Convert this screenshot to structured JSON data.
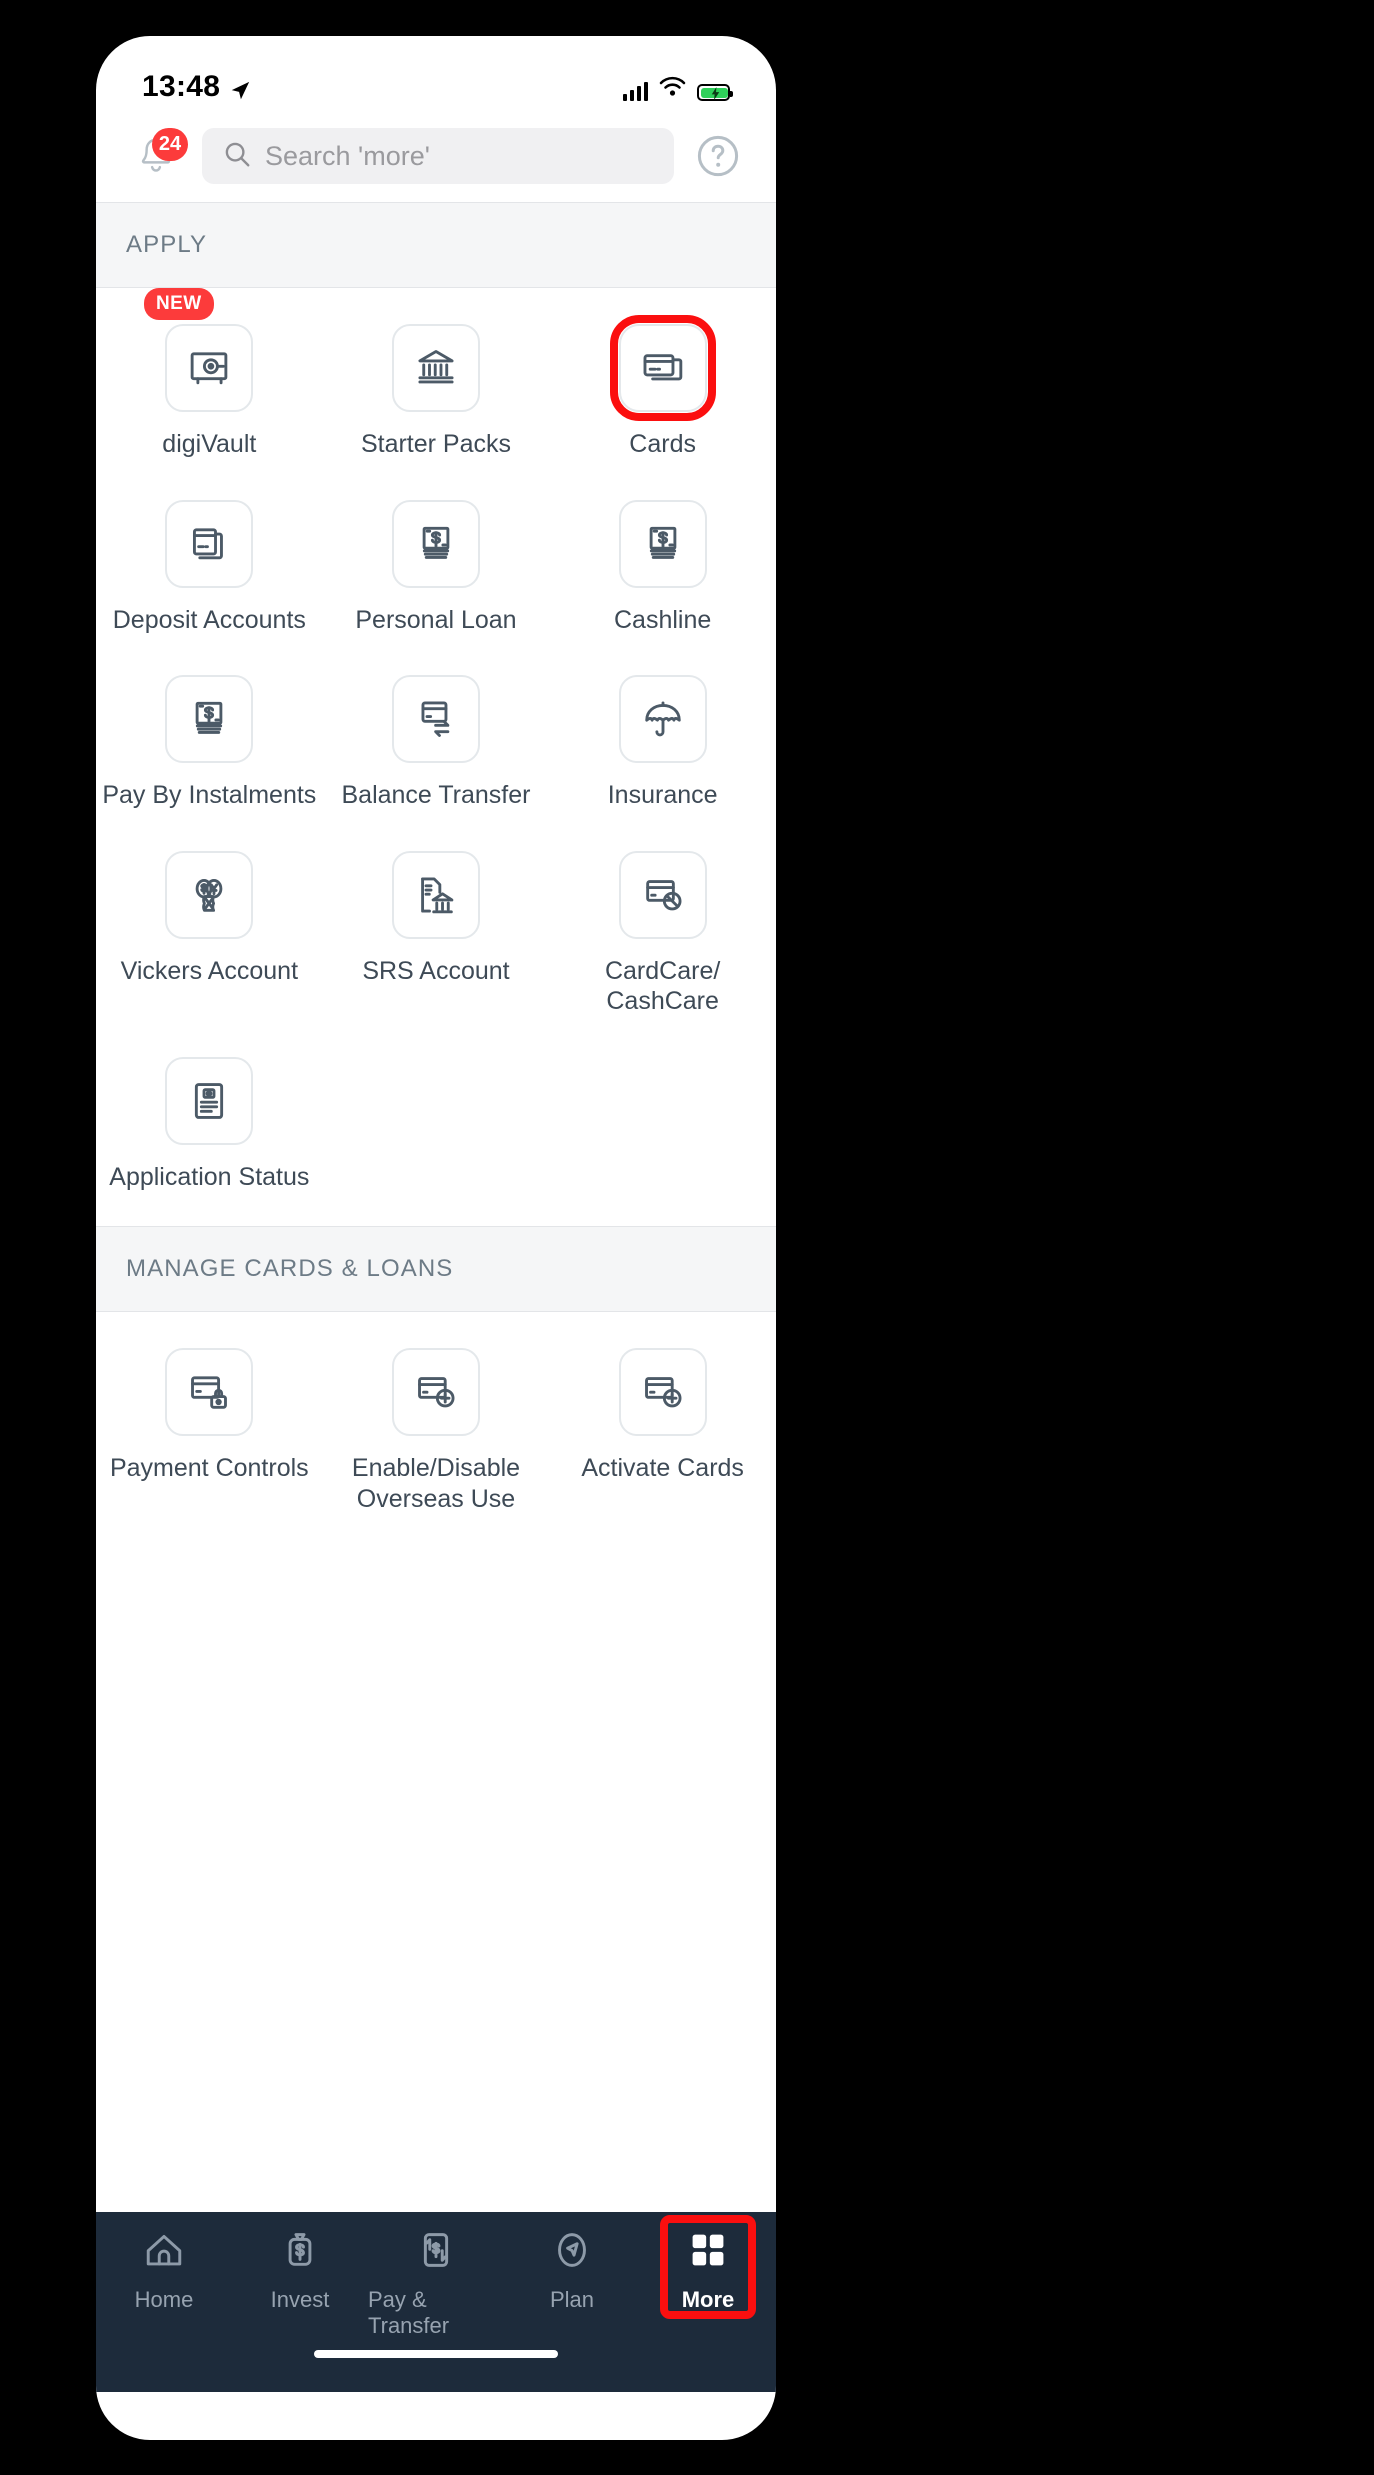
{
  "status_bar": {
    "time": "13:48",
    "location_icon": "location-arrow-icon",
    "signal_icon": "cellular-signal-icon",
    "wifi_icon": "wifi-icon",
    "battery_icon": "battery-charging-icon"
  },
  "header": {
    "notifications": {
      "icon": "bell-icon",
      "count": "24"
    },
    "search": {
      "icon": "search-icon",
      "placeholder": "Search 'more'",
      "value": ""
    },
    "help": {
      "icon": "help-circle-icon"
    }
  },
  "sections": [
    {
      "title": "APPLY",
      "items": [
        {
          "label": "digiVault",
          "icon": "vault-icon",
          "badge": "NEW",
          "highlighted": false
        },
        {
          "label": "Starter Packs",
          "icon": "bank-building-icon",
          "badge": "",
          "highlighted": false
        },
        {
          "label": "Cards",
          "icon": "credit-cards-icon",
          "badge": "",
          "highlighted": true
        },
        {
          "label": "Deposit Accounts",
          "icon": "stacked-cards-icon",
          "badge": "",
          "highlighted": false
        },
        {
          "label": "Personal Loan",
          "icon": "cash-note-icon",
          "badge": "",
          "highlighted": false
        },
        {
          "label": "Cashline",
          "icon": "cash-note-icon",
          "badge": "",
          "highlighted": false
        },
        {
          "label": "Pay By Instalments",
          "icon": "cash-note-icon",
          "badge": "",
          "highlighted": false
        },
        {
          "label": "Balance Transfer",
          "icon": "card-transfer-icon",
          "badge": "",
          "highlighted": false
        },
        {
          "label": "Insurance",
          "icon": "umbrella-icon",
          "badge": "",
          "highlighted": false
        },
        {
          "label": "Vickers Account",
          "icon": "currency-exchange-icon",
          "badge": "",
          "highlighted": false
        },
        {
          "label": "SRS Account",
          "icon": "document-bank-icon",
          "badge": "",
          "highlighted": false
        },
        {
          "label": "CardCare/\nCashCare",
          "icon": "card-blocked-icon",
          "badge": "",
          "highlighted": false
        },
        {
          "label": "Application Status",
          "icon": "application-doc-icon",
          "badge": "",
          "highlighted": false
        }
      ]
    },
    {
      "title": "MANAGE CARDS & LOANS",
      "items": [
        {
          "label": "Payment Controls",
          "icon": "card-lock-icon",
          "badge": "",
          "highlighted": false
        },
        {
          "label": "Enable/Disable\nOverseas Use",
          "icon": "card-plus-icon",
          "badge": "",
          "highlighted": false
        },
        {
          "label": "Activate Cards",
          "icon": "card-plus-icon",
          "badge": "",
          "highlighted": false
        }
      ]
    }
  ],
  "tabbar": {
    "tabs": [
      {
        "label": "Home",
        "icon": "home-icon",
        "active": false
      },
      {
        "label": "Invest",
        "icon": "money-bag-icon",
        "active": false
      },
      {
        "label": "Pay & Transfer",
        "icon": "transfer-icon",
        "active": false
      },
      {
        "label": "Plan",
        "icon": "compass-icon",
        "active": false
      },
      {
        "label": "More",
        "icon": "grid-squares-icon",
        "active": true
      }
    ]
  },
  "colors": {
    "accent_red": "#fb0f0f",
    "badge_red": "#fc3b3b",
    "nav_dark": "#1d2b3b",
    "icon_gray": "#4c5a67",
    "section_band": "#f5f6f7"
  }
}
